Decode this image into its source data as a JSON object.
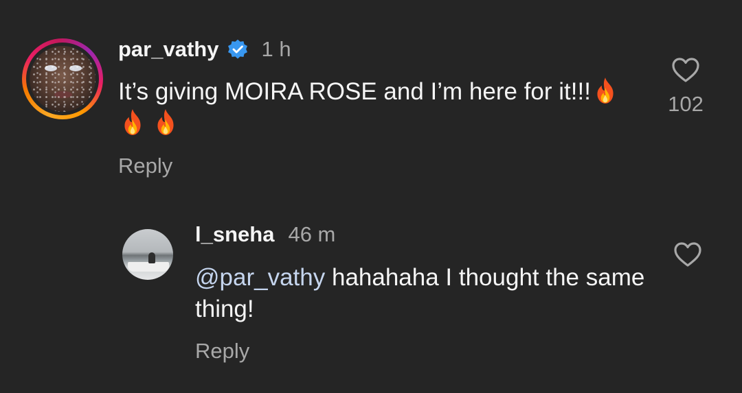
{
  "comments": [
    {
      "username": "par_vathy",
      "verified": true,
      "time": "1 h",
      "text": "It’s giving MOIRA ROSE and I’m here for it!!!",
      "emoji": [
        "fire",
        "fire",
        "fire"
      ],
      "reply_label": "Reply",
      "like_count": "102"
    },
    {
      "username": "l_sneha",
      "time": "46 m",
      "mention": "@par_vathy",
      "text": " hahahaha I thought the same thing!",
      "reply_label": "Reply"
    }
  ],
  "colors": {
    "background": "#252525",
    "primary_text": "#f5f5f5",
    "secondary_text": "#a8a8a8",
    "mention": "#c5d5ee",
    "verified_badge": "#3897f0"
  },
  "icons": {
    "like": "heart-outline-icon",
    "verified": "verified-badge-icon"
  }
}
